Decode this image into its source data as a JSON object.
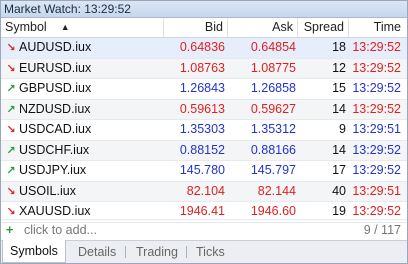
{
  "window": {
    "title": "Market Watch: 13:29:52"
  },
  "columns": {
    "symbol": "Symbol",
    "bid": "Bid",
    "ask": "Ask",
    "spread": "Spread",
    "time": "Time"
  },
  "rows": [
    {
      "symbol": "AUDUSD.iux",
      "dir": "down",
      "bid": "0.64836",
      "ask": "0.64854",
      "spread": "18",
      "time": "13:29:52",
      "color": "red"
    },
    {
      "symbol": "EURUSD.iux",
      "dir": "down",
      "bid": "1.08763",
      "ask": "1.08775",
      "spread": "12",
      "time": "13:29:52",
      "color": "red"
    },
    {
      "symbol": "GBPUSD.iux",
      "dir": "up",
      "bid": "1.26843",
      "ask": "1.26858",
      "spread": "15",
      "time": "13:29:52",
      "color": "blue"
    },
    {
      "symbol": "NZDUSD.iux",
      "dir": "up",
      "bid": "0.59613",
      "ask": "0.59627",
      "spread": "14",
      "time": "13:29:52",
      "color": "red"
    },
    {
      "symbol": "USDCAD.iux",
      "dir": "down",
      "bid": "1.35303",
      "ask": "1.35312",
      "spread": "9",
      "time": "13:29:51",
      "color": "blue"
    },
    {
      "symbol": "USDCHF.iux",
      "dir": "up",
      "bid": "0.88152",
      "ask": "0.88166",
      "spread": "14",
      "time": "13:29:52",
      "color": "blue"
    },
    {
      "symbol": "USDJPY.iux",
      "dir": "up",
      "bid": "145.780",
      "ask": "145.797",
      "spread": "17",
      "time": "13:29:52",
      "color": "blue"
    },
    {
      "symbol": "USOIL.iux",
      "dir": "down",
      "bid": "82.104",
      "ask": "82.144",
      "spread": "40",
      "time": "13:29:51",
      "color": "red"
    },
    {
      "symbol": "XAUUSD.iux",
      "dir": "down",
      "bid": "1946.41",
      "ask": "1946.60",
      "spread": "19",
      "time": "13:29:52",
      "color": "red"
    }
  ],
  "add_row": {
    "label": "click to add...",
    "count": "9 / 117"
  },
  "tabs": [
    "Symbols",
    "Details",
    "Trading",
    "Ticks"
  ],
  "colors": {
    "up": "#1e9e3a",
    "down": "#d62a2a",
    "price_red": "#e02020",
    "price_blue": "#2234cc",
    "selected_row": "#e7eefb"
  }
}
